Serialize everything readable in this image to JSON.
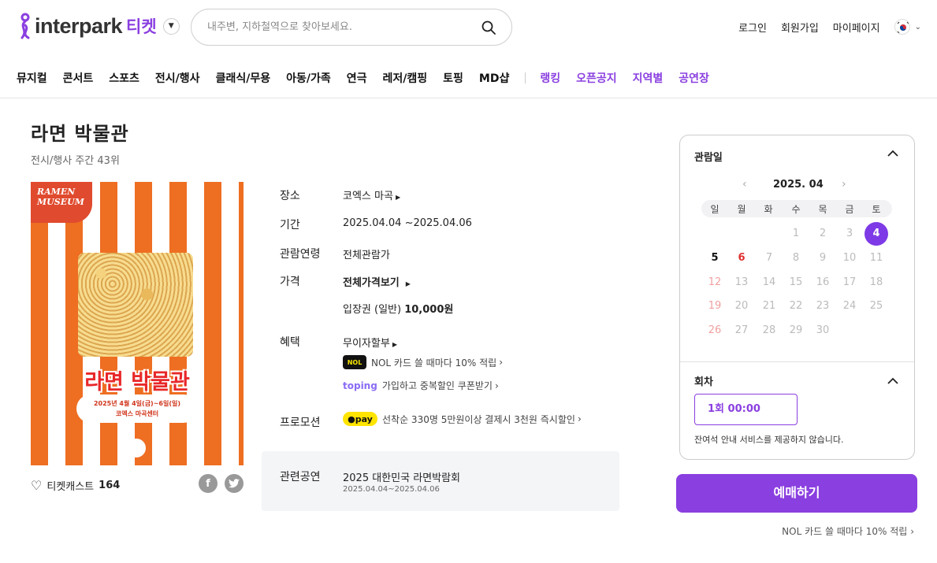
{
  "header": {
    "logo_text": "interpark",
    "logo_ticket": "티켓",
    "search_placeholder": "내주변, 지하철역으로 찾아보세요.",
    "links": [
      "로그인",
      "회원가입",
      "마이페이지"
    ]
  },
  "nav": {
    "items": [
      "뮤지컬",
      "콘서트",
      "스포츠",
      "전시/행사",
      "클래식/무용",
      "아동/가족",
      "연극",
      "레저/캠핑",
      "토핑",
      "MD샵"
    ],
    "purple_items": [
      "랭킹",
      "오픈공지",
      "지역별",
      "공연장"
    ]
  },
  "product": {
    "title": "라면 박물관",
    "subtitle": "전시/행사 주간 43위",
    "poster": {
      "badge": "RAMEN MUSEUM",
      "title": "라면 박물관",
      "date_line1": "2025년 4월 4일(금)~6일(일)",
      "date_line2": "코엑스 마곡센터"
    },
    "like_label": "티켓캐스트",
    "like_count": "164",
    "info": {
      "place_label": "장소",
      "place": "코엑스 마곡",
      "period_label": "기간",
      "period": "2025.04.04 ~2025.04.06",
      "age_label": "관람연령",
      "age": "전체관람가",
      "price_label": "가격",
      "price_all": "전체가격보기",
      "ticket_type": "입장권 (일반)",
      "ticket_price": "10,000원",
      "benefit_label": "혜택",
      "benefit_installment": "무이자할부",
      "benefit_nol": "NOL 카드 쓸 때마다 10% 적립",
      "benefit_toping": "가입하고 중복할인 쿠폰받기",
      "promo_label": "프로모션",
      "promo": "선착순 330명 5만원이상 결제시 3천원 즉시할인"
    },
    "related": {
      "label": "관련공연",
      "title": "2025 대한민국 라면박람회",
      "dates": "2025.04.04~2025.04.06"
    }
  },
  "booking": {
    "date_label": "관람일",
    "month": "2025. 04",
    "weekdays": [
      "일",
      "월",
      "화",
      "수",
      "목",
      "금",
      "토"
    ],
    "days": [
      "1",
      "2",
      "3",
      "4",
      "5",
      "6",
      "7",
      "8",
      "9",
      "10",
      "11",
      "12",
      "13",
      "14",
      "15",
      "16",
      "17",
      "18",
      "19",
      "20",
      "21",
      "22",
      "23",
      "24",
      "25",
      "26",
      "27",
      "28",
      "29",
      "30"
    ],
    "selected_day": "4",
    "session_label": "회차",
    "session": "1회 00:00",
    "note": "잔여석 안내 서비스를 제공하지 않습니다.",
    "book_button": "예매하기",
    "nol_note": "NOL 카드 쓸 때마다 10% 적립"
  },
  "colors": {
    "accent": "#8a3fe0",
    "poster_orange": "#ee6e22"
  }
}
